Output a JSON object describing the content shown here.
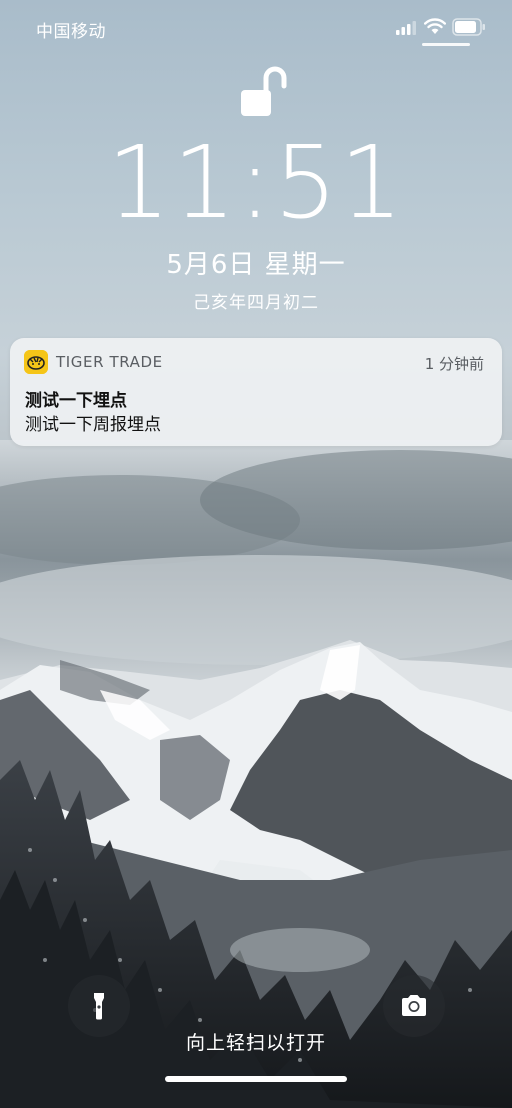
{
  "status_bar": {
    "carrier": "中国移动",
    "signal_icon": "cellular-signal-icon",
    "wifi_icon": "wifi-icon",
    "battery_icon": "battery-icon"
  },
  "lock_screen": {
    "lock_icon": "unlocked-padlock-icon",
    "time": "11:51",
    "date": "5月6日 星期一",
    "lunar_date": "己亥年四月初二"
  },
  "notification": {
    "app_name": "TIGER TRADE",
    "app_icon": "tiger-trade-app-icon",
    "time_ago": "1 分钟前",
    "title": "测试一下埋点",
    "body": "测试一下周报埋点"
  },
  "bottom": {
    "flashlight_icon": "flashlight-icon",
    "camera_icon": "camera-icon",
    "unlock_hint": "向上轻扫以打开"
  },
  "colors": {
    "notification_bg": "#f0f2f4",
    "app_icon_yellow": "#f5c518",
    "text_white": "#ffffff"
  }
}
